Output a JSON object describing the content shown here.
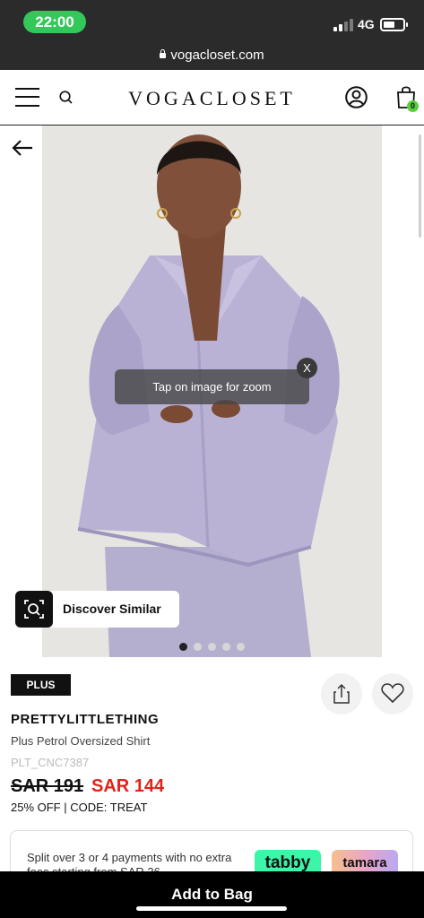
{
  "status_bar": {
    "time": "22:00",
    "network": "4G"
  },
  "browser": {
    "url": "vogacloset.com"
  },
  "header": {
    "logo": "VOGACLOSET",
    "bag_count": "0"
  },
  "gallery": {
    "zoom_hint": "Tap on image for zoom",
    "close_label": "X",
    "discover_label": "Discover Similar",
    "image_count": 5,
    "active_index": 0
  },
  "product": {
    "badge": "PLUS",
    "brand": "PRETTYLITTLETHING",
    "name": "Plus Petrol Oversized Shirt",
    "sku": "PLT_CNC7387",
    "old_price": "SAR 191",
    "new_price": "SAR 144",
    "promo": "25% OFF | CODE: TREAT"
  },
  "payment": {
    "text": "Split over 3 or 4 payments with no extra fees starting from SAR 36",
    "tabby": "tabby",
    "tamara": "tamara"
  },
  "cta": {
    "add_to_bag": "Add to Bag"
  },
  "colors": {
    "accent_green": "#34c759",
    "sale_red": "#e2231a",
    "tabby_green": "#3bf5a8",
    "shirt_lilac": "#b7b0d3"
  }
}
